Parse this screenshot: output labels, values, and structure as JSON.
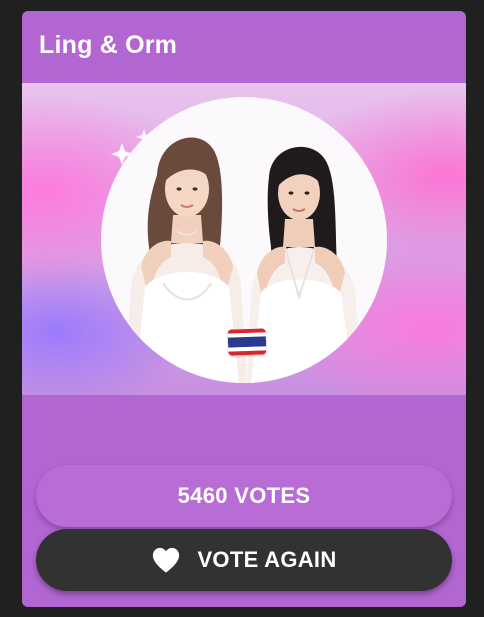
{
  "card": {
    "title": "Ling & Orm",
    "background": "#b266d1",
    "photo": {
      "subject": "two-women-portrait",
      "flag_icon": "thailand-flag-icon"
    }
  },
  "votes": {
    "label": "5460 VOTES",
    "count": 5460
  },
  "vote_button": {
    "label": "VOTE AGAIN",
    "icon": "heart-icon",
    "background": "#323232"
  }
}
